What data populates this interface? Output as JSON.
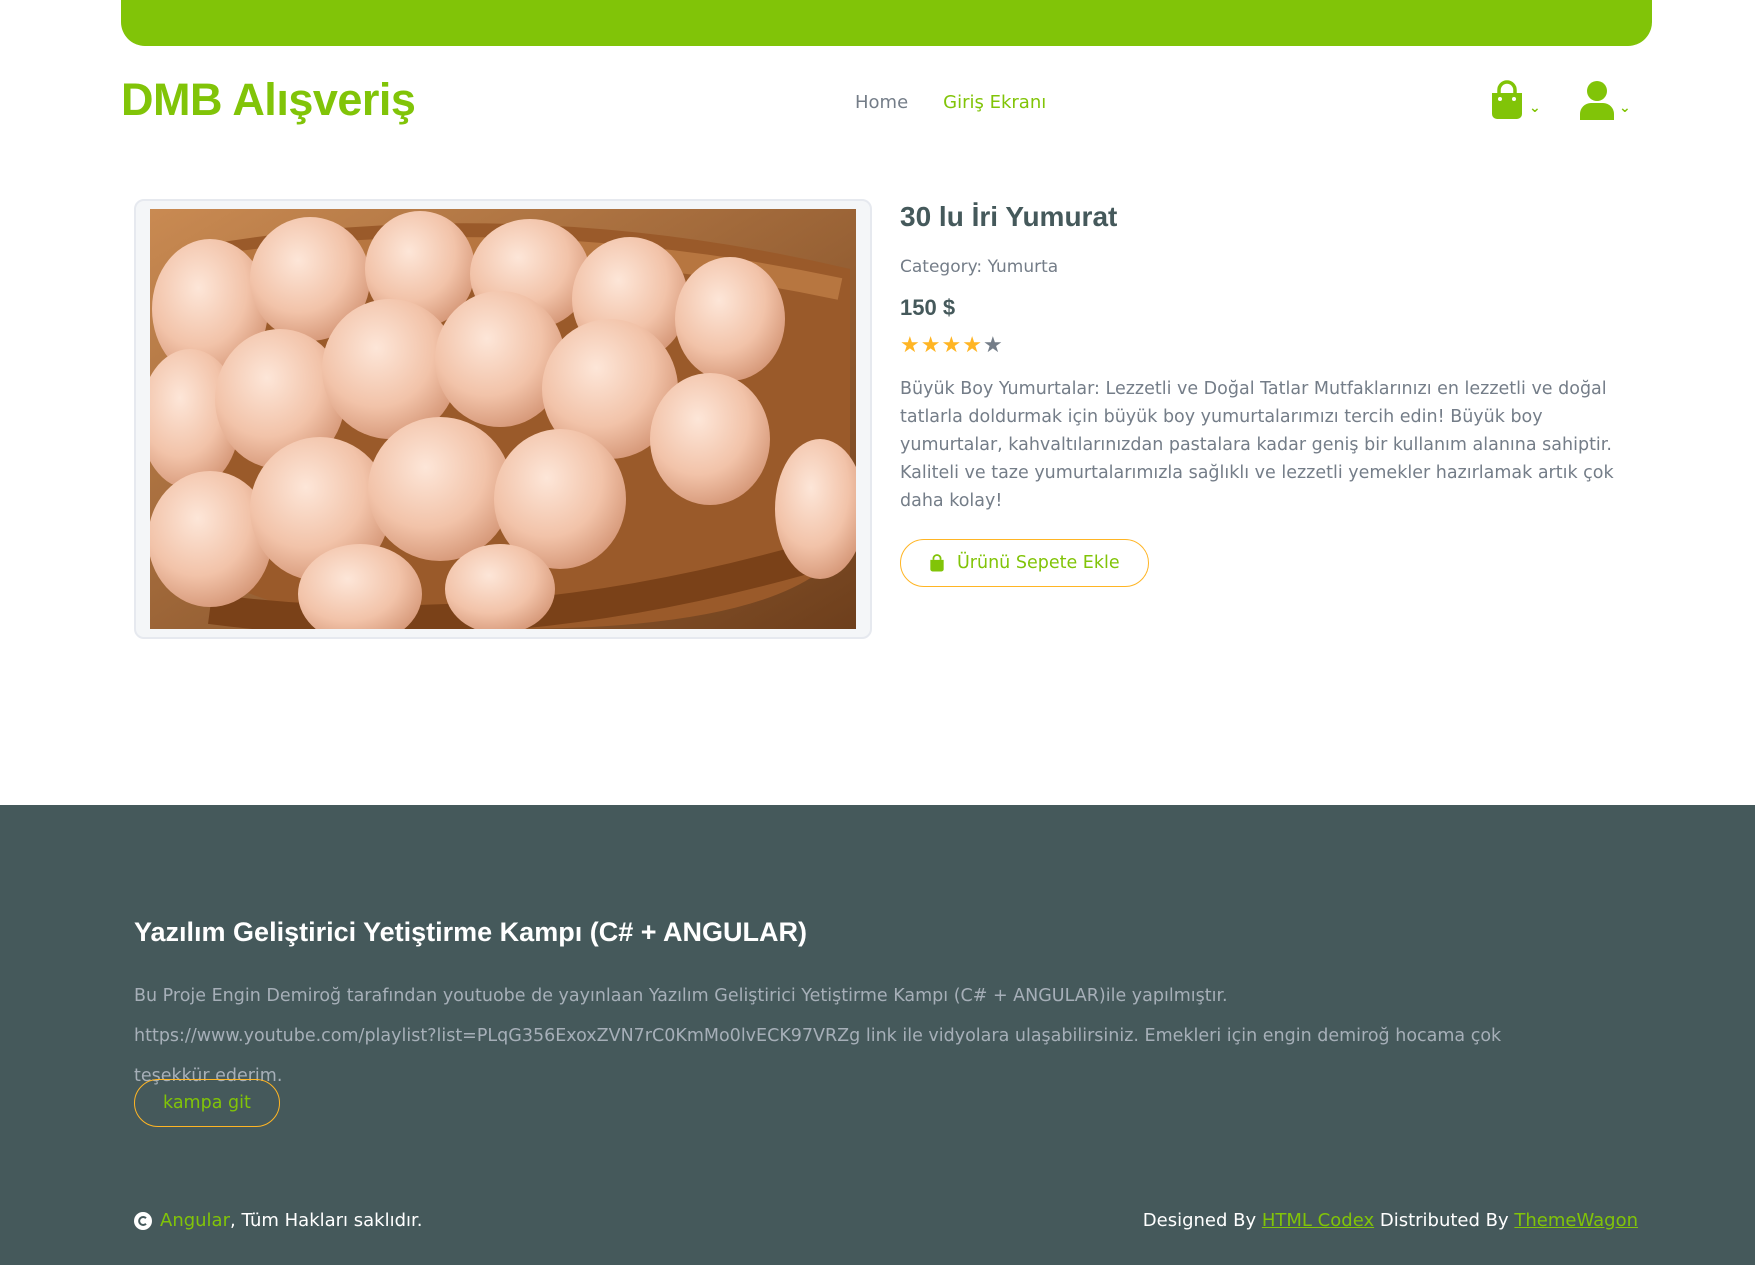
{
  "brand": {
    "name": "DMB Alışveriş"
  },
  "nav": {
    "links": [
      {
        "label": "Home",
        "active": false
      },
      {
        "label": "Giriş Ekranı",
        "active": true
      }
    ],
    "cart_icon": "shopping-bag-icon",
    "user_icon": "user-icon"
  },
  "product": {
    "title": "30 lu İri Yumurat",
    "category_label": "Category:",
    "category": "Yumurta",
    "price": "150 $",
    "rating": 4,
    "rating_max": 5,
    "description": "Büyük Boy Yumurtalar: Lezzetli ve Doğal Tatlar Mutfaklarınızı en lezzetli ve doğal tatlarla doldurmak için büyük boy yumurtalarımızı tercih edin! Büyük boy yumurtalar, kahvaltılarınızdan pastalara kadar geniş bir kullanım alanına sahiptir. Kaliteli ve taze yumurtalarımızla sağlıklı ve lezzetli yemekler hazırlamak artık çok daha kolay!",
    "add_to_cart_label": "Ürünü Sepete Ekle"
  },
  "footer": {
    "title": "Yazılım Geliştirici Yetiştirme Kampı (C# + ANGULAR)",
    "description": "Bu Proje Engin Demiroğ tarafından youtuobe de yayınlaan Yazılım Geliştirici Yetiştirme Kampı (C# + ANGULAR)ile yapılmıştır. https://www.youtube.com/playlist?list=PLqG356ExoxZVN7rC0KmMo0lvECK97VRZg link ile vidyolara ulaşabilirsiniz. Emekleri için engin demiroğ hocama çok teşekkür ederim.",
    "button_label": "kampa git",
    "copyright_link": "Angular",
    "copyright_text": ", Tüm Hakları saklıdır.",
    "designed_by_label": "Designed By",
    "designed_by_link": "HTML Codex",
    "distributed_by_label": "Distributed By",
    "distributed_by_link": "ThemeWagon"
  },
  "colors": {
    "primary": "#81c408",
    "secondary": "#ffb524",
    "dark": "#45595b",
    "muted": "#747d88"
  }
}
